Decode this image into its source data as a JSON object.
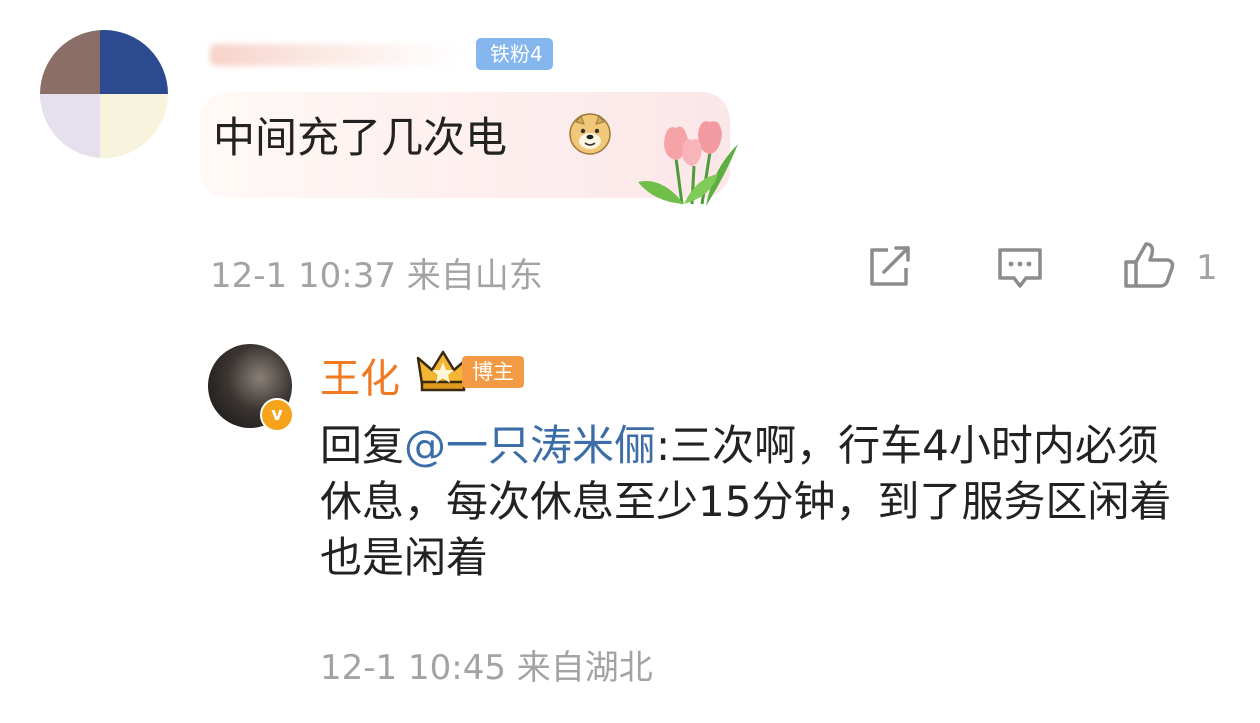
{
  "comment": {
    "fan_badge": "铁粉4",
    "text": "中间充了几次电",
    "timestamp": "12-1 10:37",
    "location": "来自山东",
    "like_count": "1",
    "icons": [
      "share-icon",
      "comment-icon",
      "like-icon",
      "doge-emoji",
      "tulip-sticker"
    ]
  },
  "reply": {
    "author": "王化",
    "author_badge": "博主",
    "prefix": "回复",
    "mention": "@一只涛米俪",
    "text": ":三次啊，行车4小时内必须休息，每次休息至少15分钟，到了服务区闲着也是闲着",
    "timestamp": "12-1 10:45",
    "location": "来自湖北",
    "colors": {
      "author": "#f07a22",
      "mention": "#3d6da8",
      "badge": "#f39a45"
    }
  }
}
